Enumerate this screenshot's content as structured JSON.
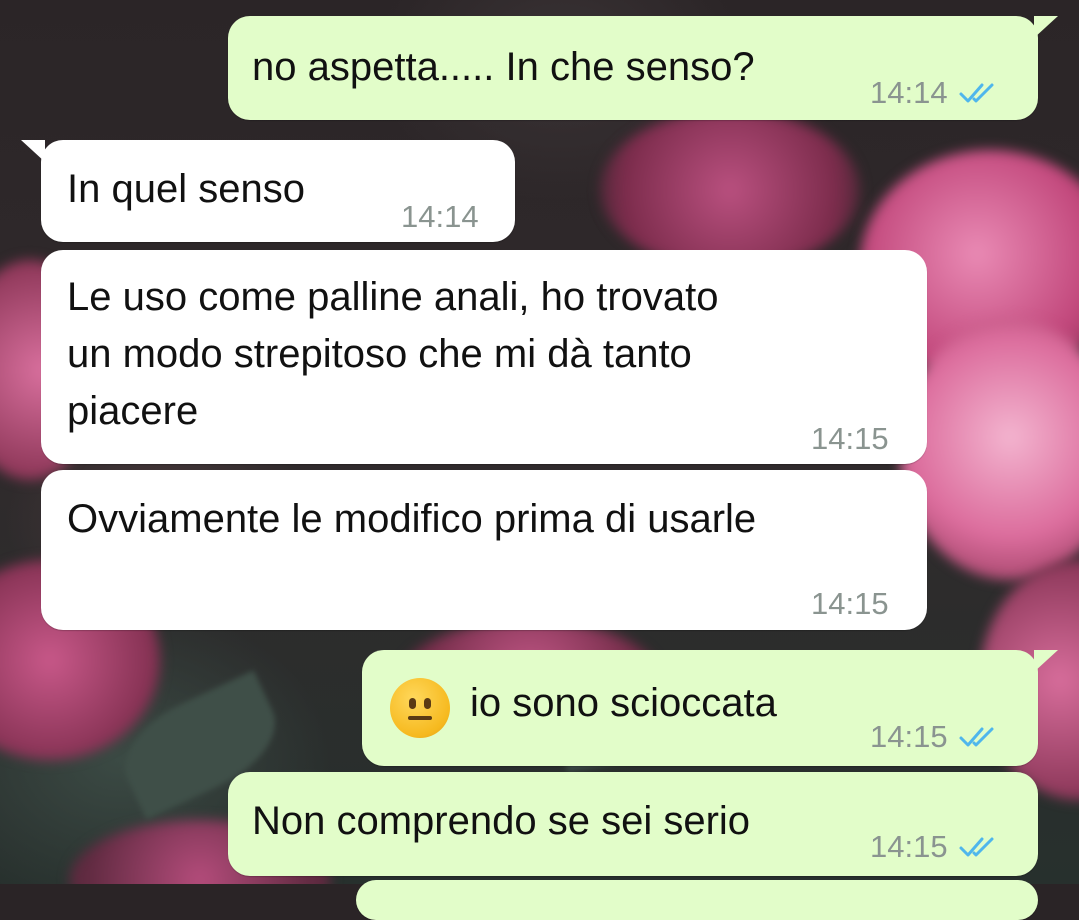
{
  "messages": [
    {
      "direction": "outgoing",
      "text": "no aspetta..... In che senso?",
      "time": "14:14",
      "status": "read"
    },
    {
      "direction": "incoming",
      "text": "In quel senso",
      "time": "14:14"
    },
    {
      "direction": "incoming",
      "lines": [
        "Le uso come palline anali, ho trovato",
        "un modo strepitoso che mi dà tanto",
        "piacere"
      ],
      "time": "14:15"
    },
    {
      "direction": "incoming",
      "text": "Ovviamente le modifico prima di usarle",
      "time": "14:15"
    },
    {
      "direction": "outgoing",
      "emoji": "neutral-face-emoji",
      "text": "io sono scioccata",
      "time": "14:15",
      "status": "read"
    },
    {
      "direction": "outgoing",
      "text": "Non comprendo se sei serio",
      "time": "14:15",
      "status": "read"
    }
  ],
  "colors": {
    "outgoing_bubble": "#e2fdc9",
    "incoming_bubble": "#ffffff",
    "read_ticks": "#4fb6ec",
    "timestamp": "#8a9490"
  }
}
